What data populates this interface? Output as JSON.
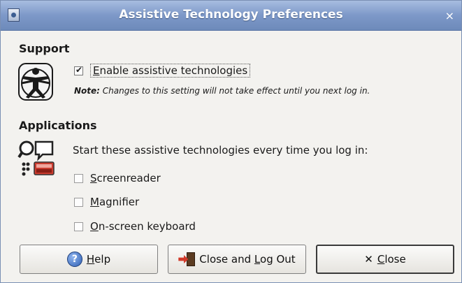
{
  "window": {
    "title": "Assistive Technology Preferences",
    "close_glyph": "×",
    "icon": "preferences-window-icon"
  },
  "support": {
    "heading": "Support",
    "icon": "accessibility-figure-icon",
    "enable": {
      "label_prefix": "",
      "label_mnemonic": "E",
      "label_rest": "nable assistive technologies",
      "checked": true
    },
    "note_bold": "Note:",
    "note_text": " Changes to this setting will not take effect until you next log in."
  },
  "applications": {
    "heading": "Applications",
    "icon": "assistive-apps-icon",
    "intro": "Start these assistive technologies every time you log in:",
    "items": [
      {
        "mnemonic": "S",
        "rest": "creenreader",
        "checked": false
      },
      {
        "mnemonic": "M",
        "rest": "agnifier",
        "checked": false
      },
      {
        "mnemonic": "O",
        "rest": "n-screen keyboard",
        "checked": false
      }
    ]
  },
  "buttons": {
    "help": {
      "mnemonic": "H",
      "rest": "elp",
      "icon": "help-icon"
    },
    "logout": {
      "prefix": "Close and ",
      "mnemonic": "L",
      "rest": "og Out",
      "icon": "logout-icon"
    },
    "close": {
      "glyph": "✕",
      "mnemonic": "C",
      "rest": "lose",
      "icon": "close-icon"
    }
  },
  "colors": {
    "titlebar": "#7d98c8",
    "window_bg": "#f3f2ef",
    "help_icon": "#2f5fb3",
    "logout_arrow": "#d23a2a"
  }
}
